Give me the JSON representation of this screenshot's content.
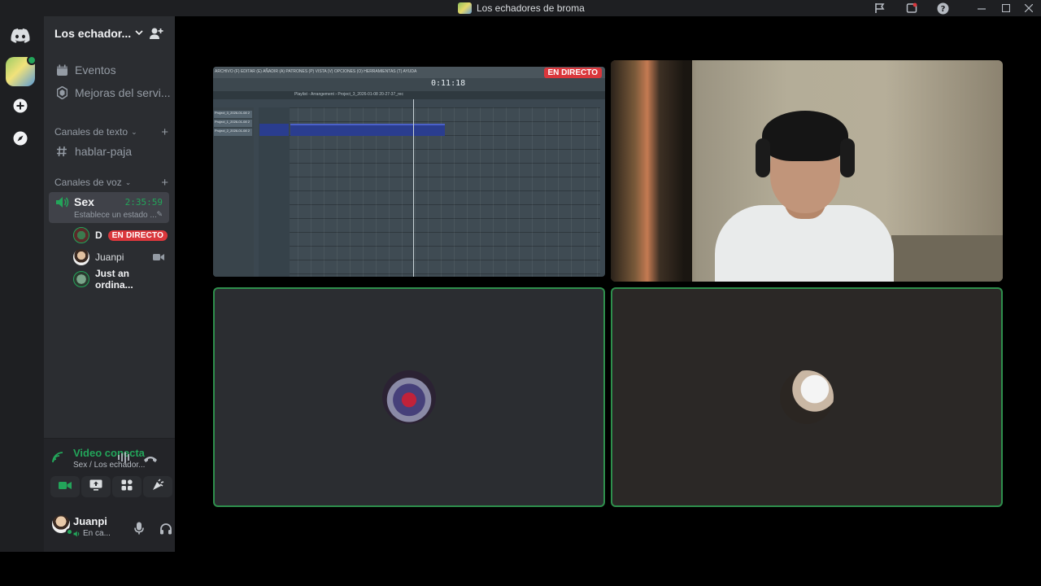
{
  "window": {
    "title": "Los echadores de broma"
  },
  "server": {
    "name": "Los echador..."
  },
  "sidebar": {
    "top_items": [
      {
        "label": "Eventos",
        "icon": "calendar-icon"
      },
      {
        "label": "Mejoras del servi...",
        "icon": "boost-icon"
      }
    ],
    "text_category": "Canales de texto",
    "text_channels": [
      {
        "label": "hablar-paja",
        "icon": "hashtag-icon"
      }
    ],
    "voice_category": "Canales de voz",
    "voice_channel": {
      "name": "Sex",
      "timer": "2:35:59",
      "status": "Establece un estado ..."
    },
    "members": [
      {
        "name": "D",
        "badge": "EN DIRECTO"
      },
      {
        "name": "Juanpi",
        "icon": "video-camera-icon"
      },
      {
        "name": "Just an ordina..."
      }
    ]
  },
  "voice_panel": {
    "status": "Video conectac",
    "location": "Sex / Los echador...",
    "buttons": [
      "camera-icon",
      "screen-share-icon",
      "activities-icon",
      "soundboard-icon"
    ]
  },
  "user": {
    "name": "Juanpi",
    "status": "En ca..."
  },
  "stage": {
    "stream_badge": "EN DIRECTO",
    "daw": {
      "menu": "ARCHIVO (F) EDITAR (E) AÑADIR (A) PATRONES (P) VISTA (V) OPCIONES (O) HERRAMIENTAS (T) AYUDA",
      "time": "0:11:18",
      "playlist_title": "Playlist - Arrangement › Project_3_2026-01-08 20-27-37_rec",
      "tracks": [
        "Project_3_2026-01-08 2",
        "Project_1_2026-01-08 2",
        "Project_2_2026-01-08 2"
      ]
    }
  },
  "colors": {
    "accent_green": "#23a55a",
    "live_red": "#da373c",
    "sidebar_bg": "#2b2d31",
    "rail_bg": "#1e1f22"
  }
}
